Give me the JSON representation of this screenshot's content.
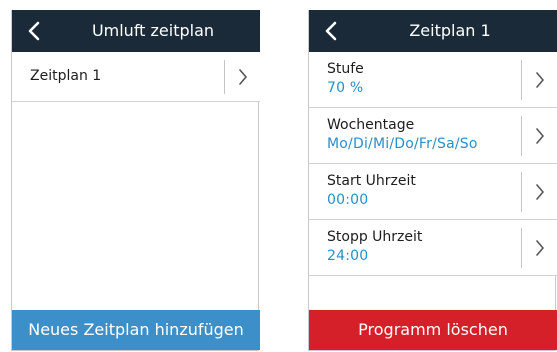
{
  "left_panel": {
    "title": "Umluft zeitplan",
    "back_icon": "chevron-left-icon",
    "items": [
      {
        "label": "Zeitplan 1",
        "icon": "chevron-right-icon"
      }
    ],
    "footer_button": {
      "label": "Neues Zeitplan hinzufügen",
      "color": "#3c8fc9"
    }
  },
  "right_panel": {
    "title": "Zeitplan 1",
    "back_icon": "chevron-left-icon",
    "settings": [
      {
        "label": "Stufe",
        "value": "70 %",
        "icon": "chevron-right-icon"
      },
      {
        "label": "Wochentage",
        "value": "Mo/Di/Mi/Do/Fr/Sa/So",
        "icon": "chevron-right-icon"
      },
      {
        "label": "Start Uhrzeit",
        "value": "00:00",
        "icon": "chevron-right-icon"
      },
      {
        "label": "Stopp Uhrzeit",
        "value": "24:00",
        "icon": "chevron-right-icon"
      }
    ],
    "footer_button": {
      "label": "Programm löschen",
      "color": "#d5202a"
    }
  },
  "colors": {
    "header_bg": "#1b2a38",
    "value_text": "#2a8fc8",
    "divider": "#d2d2d2"
  }
}
